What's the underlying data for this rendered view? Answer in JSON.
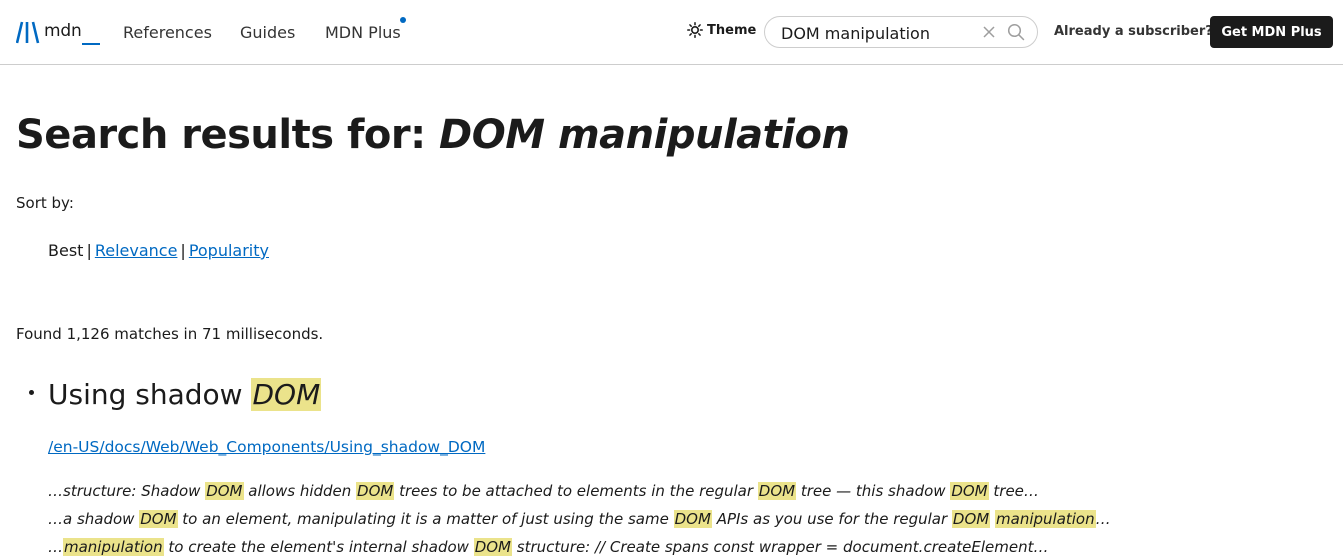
{
  "header": {
    "logo_text": "mdn",
    "nav": {
      "references": "References",
      "guides": "Guides",
      "mdn_plus": "MDN Plus"
    },
    "theme_label": "Theme",
    "search": {
      "value": "DOM manipulation",
      "placeholder": ""
    },
    "subscriber_link": "Already a subscriber?",
    "get_plus_button": "Get MDN Plus",
    "accent_color": "#0069c2"
  },
  "main": {
    "title_prefix": "Search results for:",
    "title_query": "DOM manipulation",
    "sort_label": "Sort by:",
    "sort_options": {
      "best": "Best",
      "relevance": "Relevance",
      "popularity": "Popularity"
    },
    "found_text": "Found 1,126 matches in 71 milliseconds.",
    "highlight_color": "#ebe38b",
    "results": [
      {
        "title_plain": "Using shadow",
        "title_highlight": "DOM",
        "url": "/en-US/docs/Web/Web_Components/Using_shadow_DOM",
        "snippets": [
          [
            {
              "t": "…structure: Shadow "
            },
            {
              "h": "DOM"
            },
            {
              "t": " allows hidden "
            },
            {
              "h": "DOM"
            },
            {
              "t": " trees to be attached to elements in the regular "
            },
            {
              "h": "DOM"
            },
            {
              "t": " tree — this shadow "
            },
            {
              "h": "DOM"
            },
            {
              "t": " tree…"
            }
          ],
          [
            {
              "t": "…a shadow "
            },
            {
              "h": "DOM"
            },
            {
              "t": " to an element, manipulating it is a matter of just using the same "
            },
            {
              "h": "DOM"
            },
            {
              "t": " APIs as you use for the regular "
            },
            {
              "h": "DOM"
            },
            {
              "t": " "
            },
            {
              "h": "manipulation"
            },
            {
              "t": "…"
            }
          ],
          [
            {
              "t": "…"
            },
            {
              "h": "manipulation"
            },
            {
              "t": " to create the element's internal shadow "
            },
            {
              "h": "DOM"
            },
            {
              "t": " structure: // Create spans const wrapper = document.createElement…"
            }
          ]
        ]
      }
    ]
  }
}
